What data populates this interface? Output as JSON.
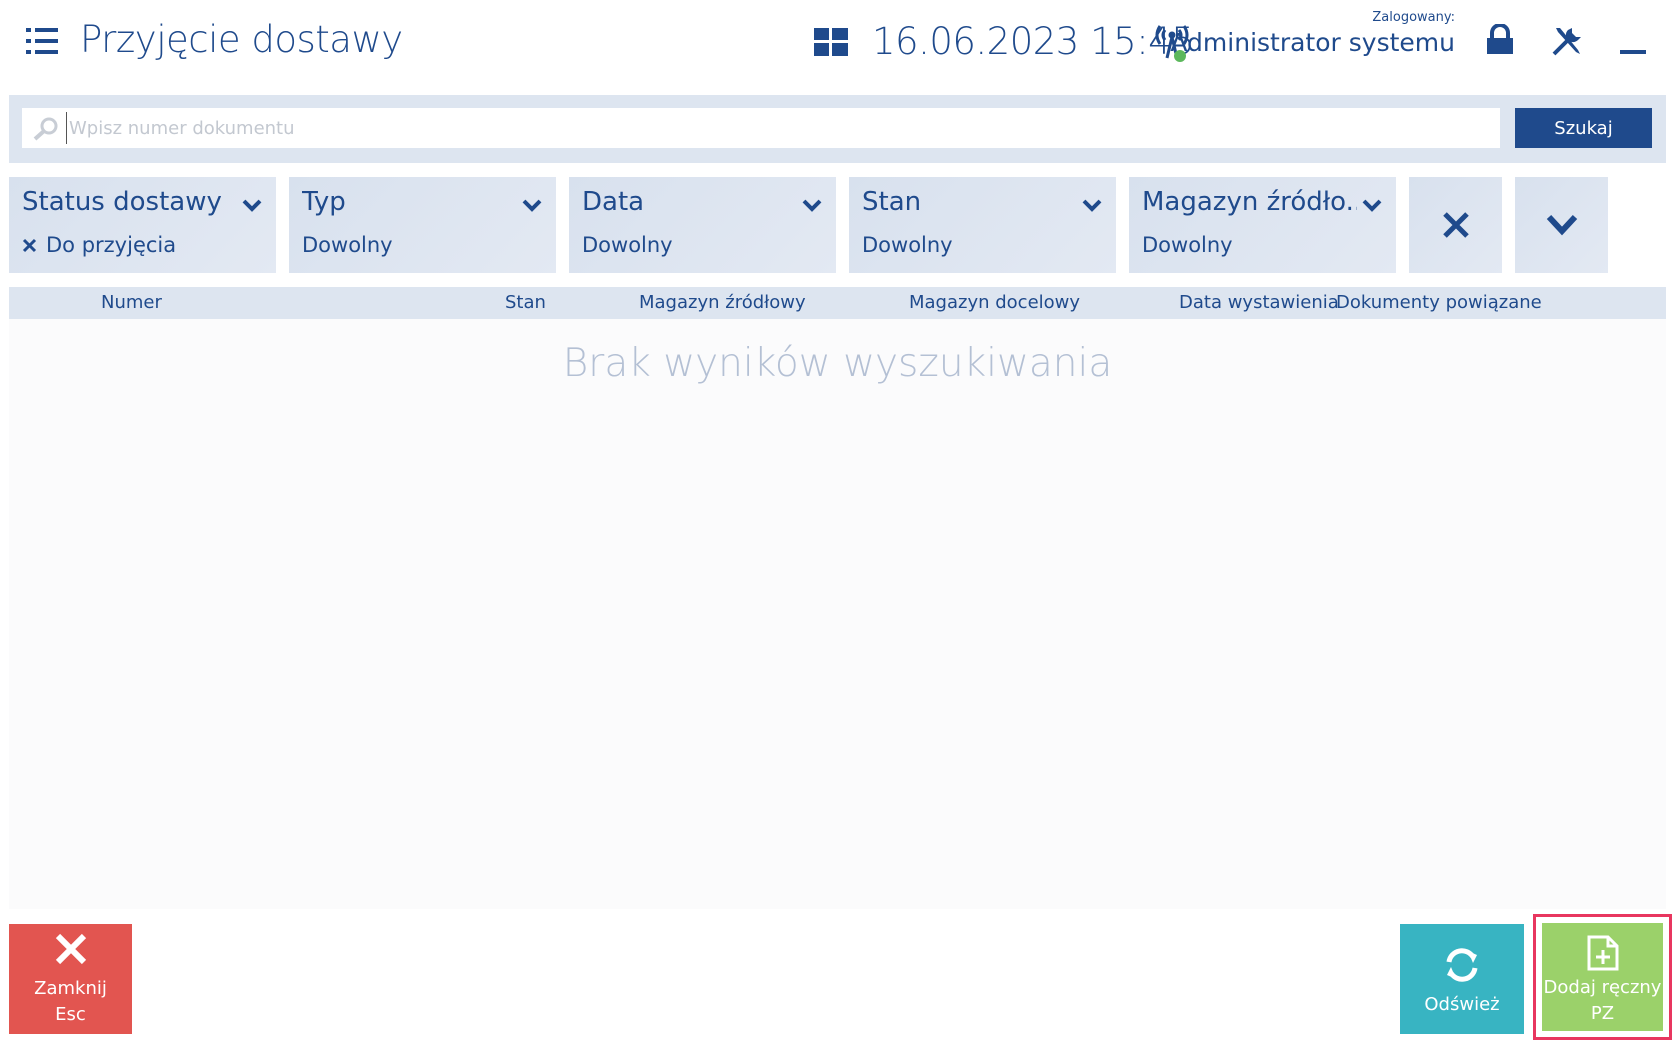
{
  "header": {
    "title": "Przyjęcie dostawy",
    "datetime": "16.06.2023 15:45",
    "logged_label": "Zalogowany:",
    "user_name": "Administrator systemu"
  },
  "search": {
    "placeholder": "Wpisz numer dokumentu",
    "value": "",
    "button_label": "Szukaj"
  },
  "filters": [
    {
      "title": "Status dostawy",
      "value": "Do przyjęcia",
      "removable": true
    },
    {
      "title": "Typ",
      "value": "Dowolny"
    },
    {
      "title": "Data",
      "value": "Dowolny"
    },
    {
      "title": "Stan",
      "value": "Dowolny"
    },
    {
      "title": "Magazyn źródło...",
      "value": "Dowolny"
    }
  ],
  "table": {
    "columns": [
      "Numer",
      "Stan",
      "Magazyn źródłowy",
      "Magazyn docelowy",
      "Data wystawienia",
      "Dokumenty powiązane"
    ],
    "empty_message": "Brak wyników wyszukiwania"
  },
  "actions": {
    "close_label": "Zamknij",
    "close_key": "Esc",
    "refresh_label": "Odśwież",
    "add_label_1": "Dodaj ręczny",
    "add_label_2": "PZ"
  },
  "colors": {
    "primary": "#1f4a8c",
    "close": "#e25550",
    "refresh": "#38b4c2",
    "add": "#9bd16a",
    "highlight": "#e8365f",
    "online": "#5cb85c"
  }
}
